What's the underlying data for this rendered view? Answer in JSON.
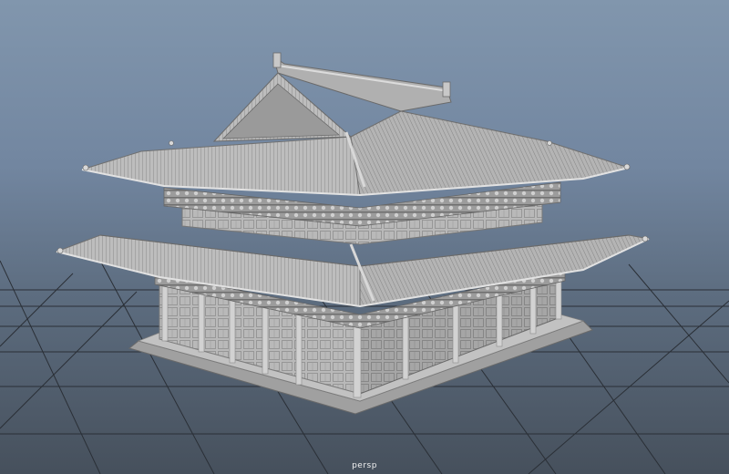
{
  "viewport": {
    "camera_label": "persp",
    "colors": {
      "background_top": "#8196ad",
      "background_bottom": "#46505c",
      "grid": "#2a2f36",
      "model_light": "#c9c9c9",
      "model_mid": "#a8a8a8",
      "model_dark": "#7a7a7a"
    }
  },
  "scene": {
    "model_icon": "pavilion-model",
    "grid_icon": "ground-grid"
  }
}
